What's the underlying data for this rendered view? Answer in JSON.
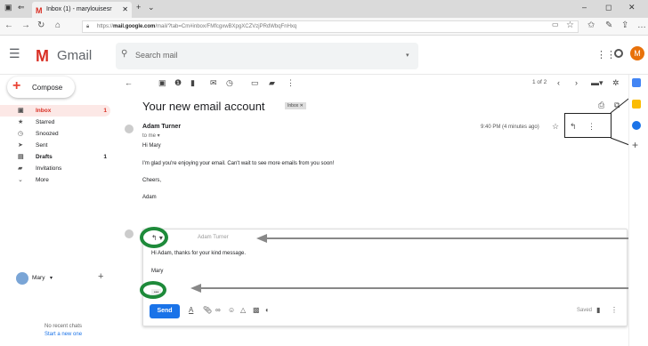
{
  "browser": {
    "tab_title": "Inbox (1) - marylouisesr",
    "url_prefix": "https://",
    "url_domain": "mail.google.com",
    "url_path": "/mail/?tab=Cm#inbox/FMfcgxwBXpgXCZVzjPRdWbqFnHxq"
  },
  "app": {
    "name": "Gmail",
    "search_placeholder": "Search mail",
    "pagination": "1 of 2"
  },
  "compose_label": "Compose",
  "sidebar": {
    "items": [
      {
        "label": "Inbox",
        "count": "1"
      },
      {
        "label": "Starred",
        "count": ""
      },
      {
        "label": "Snoozed",
        "count": ""
      },
      {
        "label": "Sent",
        "count": ""
      },
      {
        "label": "Drafts",
        "count": "1"
      },
      {
        "label": "Invitations",
        "count": ""
      },
      {
        "label": "More",
        "count": ""
      }
    ],
    "chat_user": "Mary",
    "no_chats": "No recent chats",
    "start_new": "Start a new one"
  },
  "email": {
    "subject": "Your new email account",
    "label": "Inbox",
    "sender": "Adam Turner",
    "to": "to me",
    "time": "9:40 PM (4 minutes ago)",
    "body": [
      "Hi Mary",
      "I'm glad you're enjoying your email. Can't wait to see more emails from you soon!",
      "Cheers,",
      "Adam"
    ]
  },
  "reply": {
    "to_partial": "Adam Turner",
    "line1": "Hi Adam, thanks for your kind message.",
    "line2": "Mary",
    "ellipsis": "•••",
    "send_label": "Send",
    "saved_label": "Saved"
  },
  "colors": {
    "accent": "#1a73e8",
    "brand": "#d93025",
    "highlight": "#1e8a3a"
  }
}
